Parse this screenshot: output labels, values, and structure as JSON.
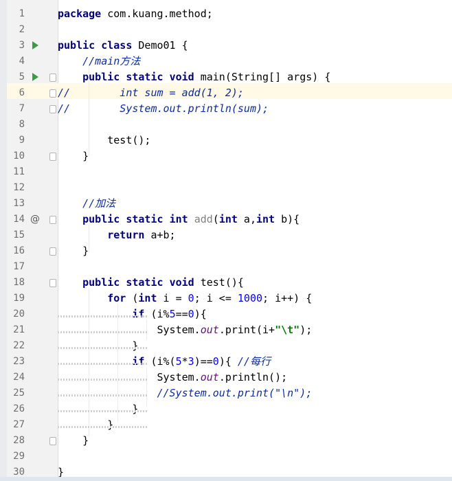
{
  "editor": {
    "lines": [
      {
        "num": "1",
        "marker": "",
        "fold": false,
        "segments": [
          {
            "t": "package",
            "c": "kw"
          },
          {
            "t": " com.kuang.method;",
            "c": ""
          }
        ]
      },
      {
        "num": "2",
        "marker": "",
        "fold": false,
        "segments": []
      },
      {
        "num": "3",
        "marker": "run",
        "fold": false,
        "segments": [
          {
            "t": "public",
            "c": "kw"
          },
          {
            "t": " ",
            "c": ""
          },
          {
            "t": "class",
            "c": "kw"
          },
          {
            "t": " Demo01 {",
            "c": ""
          }
        ]
      },
      {
        "num": "4",
        "marker": "",
        "fold": false,
        "segments": [
          {
            "t": "    ",
            "c": ""
          },
          {
            "t": "//main方法",
            "c": "cmt-d"
          }
        ]
      },
      {
        "num": "5",
        "marker": "run",
        "fold": true,
        "segments": [
          {
            "t": "    ",
            "c": ""
          },
          {
            "t": "public",
            "c": "kw"
          },
          {
            "t": " ",
            "c": ""
          },
          {
            "t": "static",
            "c": "kw"
          },
          {
            "t": " ",
            "c": ""
          },
          {
            "t": "void",
            "c": "kw"
          },
          {
            "t": " main(String[] args) {",
            "c": ""
          }
        ]
      },
      {
        "num": "6",
        "marker": "",
        "fold": true,
        "segments": [
          {
            "t": "//",
            "c": "cmt-d"
          },
          {
            "t": "        int sum = add(1, 2);",
            "c": "cmt-d"
          }
        ]
      },
      {
        "num": "7",
        "marker": "",
        "fold": true,
        "segments": [
          {
            "t": "//",
            "c": "cmt-d"
          },
          {
            "t": "        System.out.println(sum);",
            "c": "cmt-d"
          }
        ]
      },
      {
        "num": "8",
        "marker": "",
        "fold": false,
        "segments": []
      },
      {
        "num": "9",
        "marker": "",
        "fold": false,
        "segments": [
          {
            "t": "        test();",
            "c": ""
          }
        ]
      },
      {
        "num": "10",
        "marker": "",
        "fold": true,
        "segments": [
          {
            "t": "    }",
            "c": ""
          }
        ]
      },
      {
        "num": "11",
        "marker": "",
        "fold": false,
        "segments": []
      },
      {
        "num": "12",
        "marker": "",
        "fold": false,
        "segments": []
      },
      {
        "num": "13",
        "marker": "",
        "fold": false,
        "segments": [
          {
            "t": "    ",
            "c": ""
          },
          {
            "t": "//加法",
            "c": "cmt-d"
          }
        ]
      },
      {
        "num": "14",
        "marker": "at",
        "fold": true,
        "segments": [
          {
            "t": "    ",
            "c": ""
          },
          {
            "t": "public",
            "c": "kw"
          },
          {
            "t": " ",
            "c": ""
          },
          {
            "t": "static",
            "c": "kw"
          },
          {
            "t": " ",
            "c": ""
          },
          {
            "t": "int",
            "c": "kw"
          },
          {
            "t": " ",
            "c": ""
          },
          {
            "t": "add",
            "c": "unused"
          },
          {
            "t": "(",
            "c": ""
          },
          {
            "t": "int",
            "c": "kw"
          },
          {
            "t": " a,",
            "c": ""
          },
          {
            "t": "int",
            "c": "kw"
          },
          {
            "t": " b){",
            "c": ""
          }
        ]
      },
      {
        "num": "15",
        "marker": "",
        "fold": false,
        "segments": [
          {
            "t": "        ",
            "c": ""
          },
          {
            "t": "return",
            "c": "kw"
          },
          {
            "t": " a+b;",
            "c": ""
          }
        ]
      },
      {
        "num": "16",
        "marker": "",
        "fold": true,
        "segments": [
          {
            "t": "    }",
            "c": ""
          }
        ]
      },
      {
        "num": "17",
        "marker": "",
        "fold": false,
        "segments": []
      },
      {
        "num": "18",
        "marker": "",
        "fold": true,
        "segments": [
          {
            "t": "    ",
            "c": ""
          },
          {
            "t": "public",
            "c": "kw"
          },
          {
            "t": " ",
            "c": ""
          },
          {
            "t": "static",
            "c": "kw"
          },
          {
            "t": " ",
            "c": ""
          },
          {
            "t": "void",
            "c": "kw"
          },
          {
            "t": " test(){",
            "c": ""
          }
        ]
      },
      {
        "num": "19",
        "marker": "",
        "fold": false,
        "segments": [
          {
            "t": "        ",
            "c": ""
          },
          {
            "t": "for",
            "c": "kw"
          },
          {
            "t": " (",
            "c": ""
          },
          {
            "t": "int",
            "c": "kw"
          },
          {
            "t": " i = ",
            "c": ""
          },
          {
            "t": "0",
            "c": "num"
          },
          {
            "t": "; i <= ",
            "c": ""
          },
          {
            "t": "1000",
            "c": "num"
          },
          {
            "t": "; i++) {",
            "c": ""
          }
        ]
      },
      {
        "num": "20",
        "marker": "",
        "fold": false,
        "segments": [
          {
            "t": "            ",
            "c": ""
          },
          {
            "t": "if",
            "c": "kw"
          },
          {
            "t": " (i%",
            "c": ""
          },
          {
            "t": "5",
            "c": "num"
          },
          {
            "t": "==",
            "c": ""
          },
          {
            "t": "0",
            "c": "num"
          },
          {
            "t": "){",
            "c": ""
          }
        ]
      },
      {
        "num": "21",
        "marker": "",
        "fold": false,
        "segments": [
          {
            "t": "                System.",
            "c": ""
          },
          {
            "t": "out",
            "c": "st-f"
          },
          {
            "t": ".print(i+",
            "c": ""
          },
          {
            "t": "\"\\t\"",
            "c": "str"
          },
          {
            "t": ");",
            "c": ""
          }
        ]
      },
      {
        "num": "22",
        "marker": "",
        "fold": false,
        "segments": [
          {
            "t": "            }",
            "c": ""
          }
        ]
      },
      {
        "num": "23",
        "marker": "",
        "fold": false,
        "segments": [
          {
            "t": "            ",
            "c": ""
          },
          {
            "t": "if",
            "c": "kw"
          },
          {
            "t": " (i%(",
            "c": ""
          },
          {
            "t": "5",
            "c": "num"
          },
          {
            "t": "*",
            "c": ""
          },
          {
            "t": "3",
            "c": "num"
          },
          {
            "t": ")==",
            "c": ""
          },
          {
            "t": "0",
            "c": "num"
          },
          {
            "t": "){ ",
            "c": ""
          },
          {
            "t": "//每行",
            "c": "cmt-d"
          }
        ]
      },
      {
        "num": "24",
        "marker": "",
        "fold": false,
        "segments": [
          {
            "t": "                System.",
            "c": ""
          },
          {
            "t": "out",
            "c": "st-f"
          },
          {
            "t": ".println();",
            "c": ""
          }
        ]
      },
      {
        "num": "25",
        "marker": "",
        "fold": false,
        "segments": [
          {
            "t": "                ",
            "c": ""
          },
          {
            "t": "//System.out.print(\"\\n\");",
            "c": "cmt-d"
          }
        ]
      },
      {
        "num": "26",
        "marker": "",
        "fold": false,
        "segments": [
          {
            "t": "            }",
            "c": ""
          }
        ]
      },
      {
        "num": "27",
        "marker": "",
        "fold": false,
        "segments": [
          {
            "t": "        }",
            "c": ""
          }
        ]
      },
      {
        "num": "28",
        "marker": "",
        "fold": true,
        "segments": [
          {
            "t": "    }",
            "c": ""
          }
        ]
      },
      {
        "num": "29",
        "marker": "",
        "fold": false,
        "segments": []
      },
      {
        "num": "30",
        "marker": "",
        "fold": false,
        "segments": [
          {
            "t": "}",
            "c": ""
          }
        ]
      }
    ]
  },
  "colors": {
    "keyword": "#000080",
    "number": "#0000ff",
    "string": "#008000",
    "comment": "#0a2ba8",
    "static_field": "#660e7a",
    "run_icon": "#3c9b48",
    "current_line": "#fff9e6"
  }
}
